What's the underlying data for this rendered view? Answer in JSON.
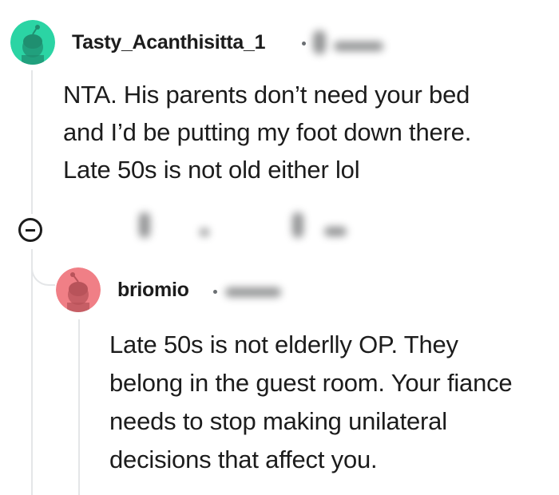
{
  "comments": [
    {
      "username": "Tasty_Acanthisitta_1",
      "avatar_color": "#2bd4a4",
      "body_lines": [
        "NTA. His parents don’t need your bed",
        "and I’d be putting my foot down there.",
        "Late 50s is not old either lol"
      ]
    },
    {
      "username": "briomio",
      "avatar_color": "#f07f86",
      "body_lines": [
        "Late 50s is not elderlly OP. They",
        "belong in the guest room. Your fiance",
        "needs to stop making unilateral",
        "decisions that affect you."
      ]
    }
  ],
  "icons": {
    "collapse": "collapse-minus-icon",
    "avatar": "snoo-avatar-icon"
  }
}
